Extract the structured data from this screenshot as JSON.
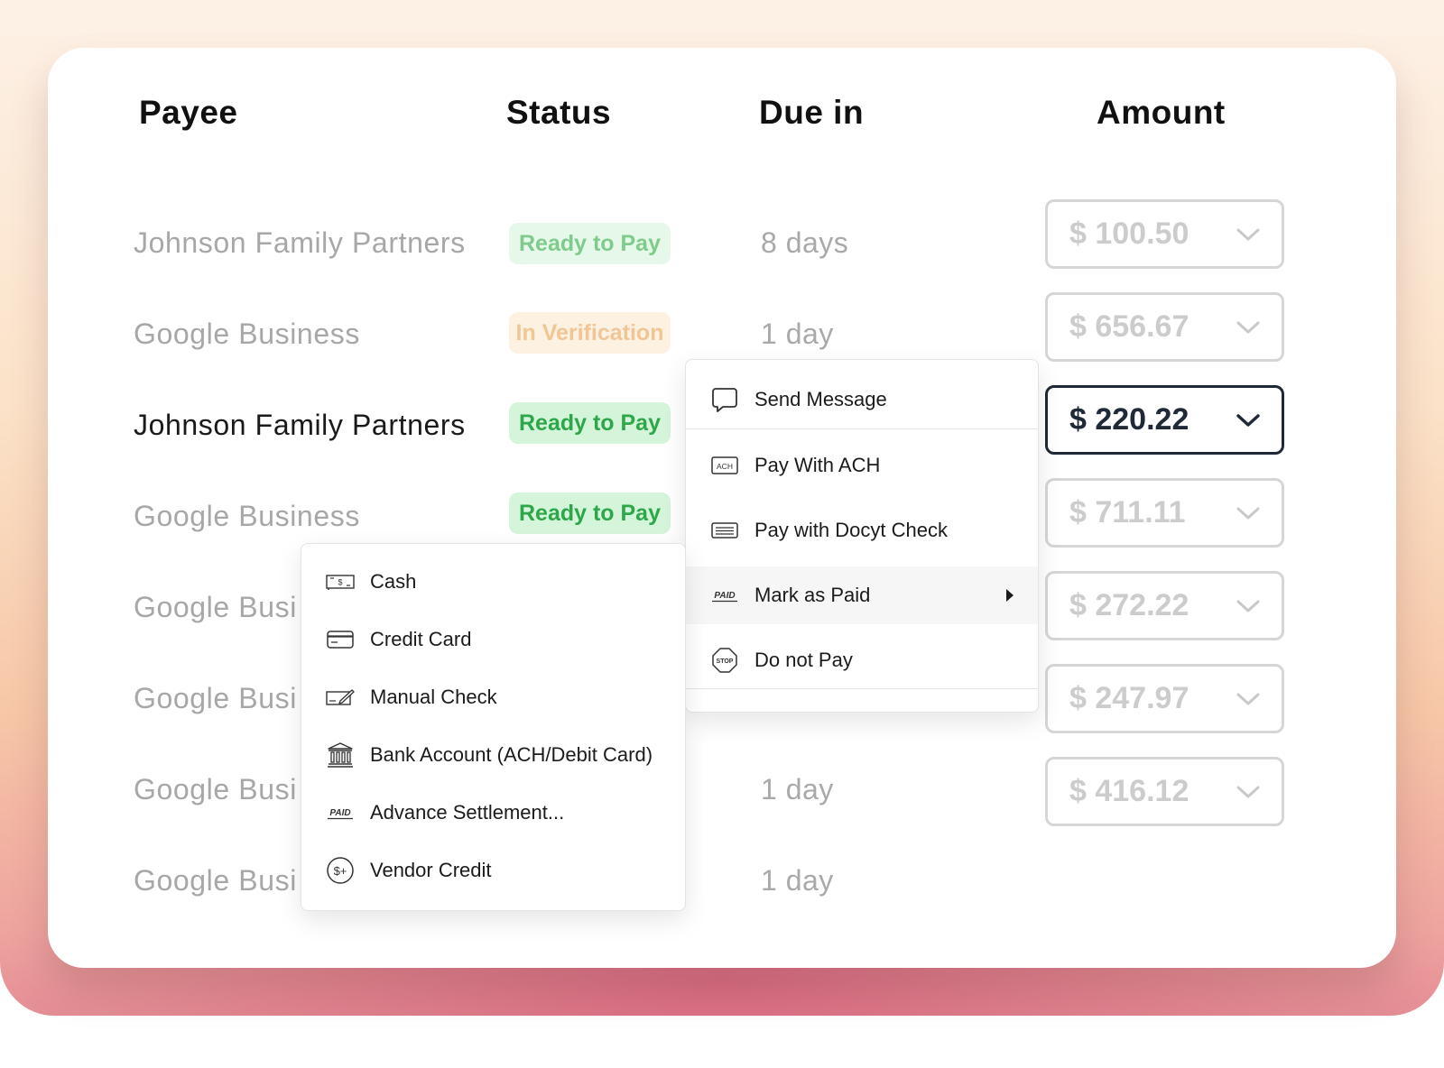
{
  "columns": {
    "payee": "Payee",
    "status": "Status",
    "due": "Due in",
    "amount": "Amount"
  },
  "rows": [
    {
      "payee": "Johnson Family Partners",
      "status": "Ready to Pay",
      "due": "8 days",
      "amount": "$ 100.50"
    },
    {
      "payee": "Google Business",
      "status": "In Verification",
      "due": "1 day",
      "amount": "$ 656.67"
    },
    {
      "payee": "Johnson Family Partners",
      "status": "Ready to Pay",
      "due": "",
      "amount": "$ 220.22"
    },
    {
      "payee": "Google Business",
      "status": "Ready to Pay",
      "due": "",
      "amount": "$ 711.11"
    },
    {
      "payee": "Google Busi",
      "status": "",
      "due": "",
      "amount": "$ 272.22"
    },
    {
      "payee": "Google Busi",
      "status": "",
      "due": "",
      "amount": "$ 247.97"
    },
    {
      "payee": "Google Busi",
      "status": "",
      "due": "1 day",
      "amount": "$ 416.12"
    },
    {
      "payee": "Google Busi",
      "status": "",
      "due": "1 day",
      "amount": ""
    }
  ],
  "actions_menu": {
    "items": [
      {
        "label": "Send Message",
        "icon": "speech-bubble-icon"
      },
      {
        "label": "Pay With ACH",
        "icon": "ach-icon",
        "icon_text": "ACH"
      },
      {
        "label": "Pay with Docyt Check",
        "icon": "check-icon"
      },
      {
        "label": "Mark as Paid",
        "icon": "paid-icon",
        "icon_text": "PAID"
      },
      {
        "label": "Do not Pay",
        "icon": "stop-icon",
        "icon_text": "STOP"
      }
    ]
  },
  "mark_paid_submenu": {
    "items": [
      {
        "label": "Cash",
        "icon": "cash-icon",
        "icon_text": "$"
      },
      {
        "label": "Credit Card",
        "icon": "credit-card-icon"
      },
      {
        "label": "Manual Check",
        "icon": "manual-check-icon"
      },
      {
        "label": "Bank Account (ACH/Debit Card)",
        "icon": "bank-icon"
      },
      {
        "label": "Advance Settlement...",
        "icon": "paid-icon",
        "icon_text": "PAID"
      },
      {
        "label": "Vendor Credit",
        "icon": "vendor-credit-icon",
        "icon_text": "$+"
      }
    ]
  },
  "colors": {
    "ready_bg": "#e6f8e9",
    "ready_text": "#2ea64a",
    "verify_bg": "#fdf1e2",
    "verify_text": "#f2c596",
    "active_border": "#1f2937"
  }
}
